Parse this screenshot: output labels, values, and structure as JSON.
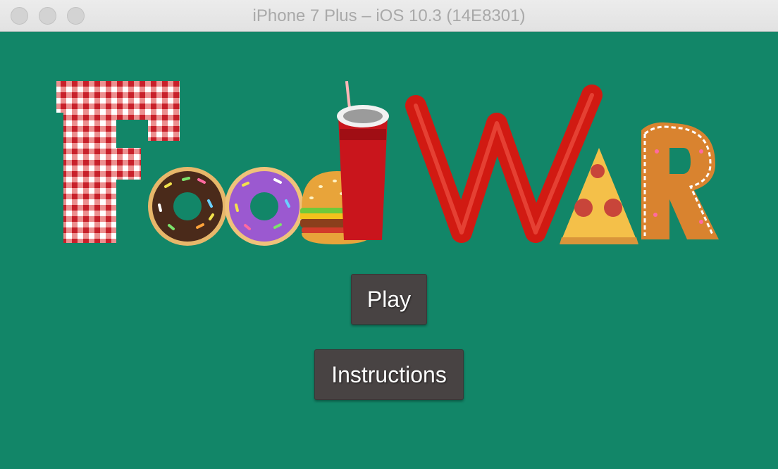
{
  "window": {
    "title": "iPhone 7 Plus – iOS 10.3 (14E8301)"
  },
  "game": {
    "logo_text": "FoodWAR",
    "background_color": "#128668"
  },
  "menu": {
    "play_label": "Play",
    "instructions_label": "Instructions"
  },
  "colors": {
    "button_bg": "#484343",
    "ketchup": "#d11a12",
    "checker_red": "#e03a3a",
    "chocolate": "#4a2a1a",
    "purple_glaze": "#9b59d0",
    "cookie": "#d9832f"
  }
}
